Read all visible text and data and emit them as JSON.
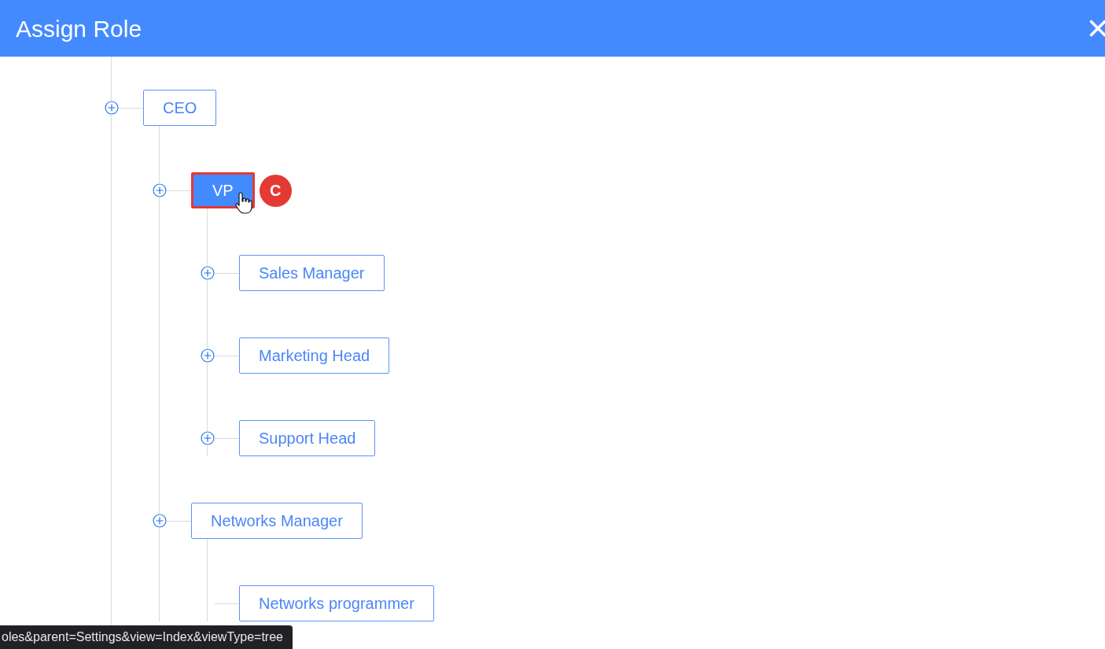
{
  "dialog": {
    "title": "Assign Role"
  },
  "tree": [
    {
      "label": "CEO",
      "selected": false,
      "expandable": true,
      "children": [
        {
          "label": "VP",
          "selected": true,
          "expandable": true,
          "callout": "C",
          "children": [
            {
              "label": "Sales Manager",
              "selected": false,
              "expandable": true
            },
            {
              "label": "Marketing Head",
              "selected": false,
              "expandable": true
            },
            {
              "label": "Support Head",
              "selected": false,
              "expandable": true
            }
          ]
        },
        {
          "label": "Networks Manager",
          "selected": false,
          "expandable": true,
          "children": [
            {
              "label": "Networks programmer",
              "selected": false,
              "expandable": false
            }
          ]
        }
      ]
    }
  ],
  "status_bar": {
    "url": "oles&parent=Settings&view=Index&viewType=tree"
  }
}
